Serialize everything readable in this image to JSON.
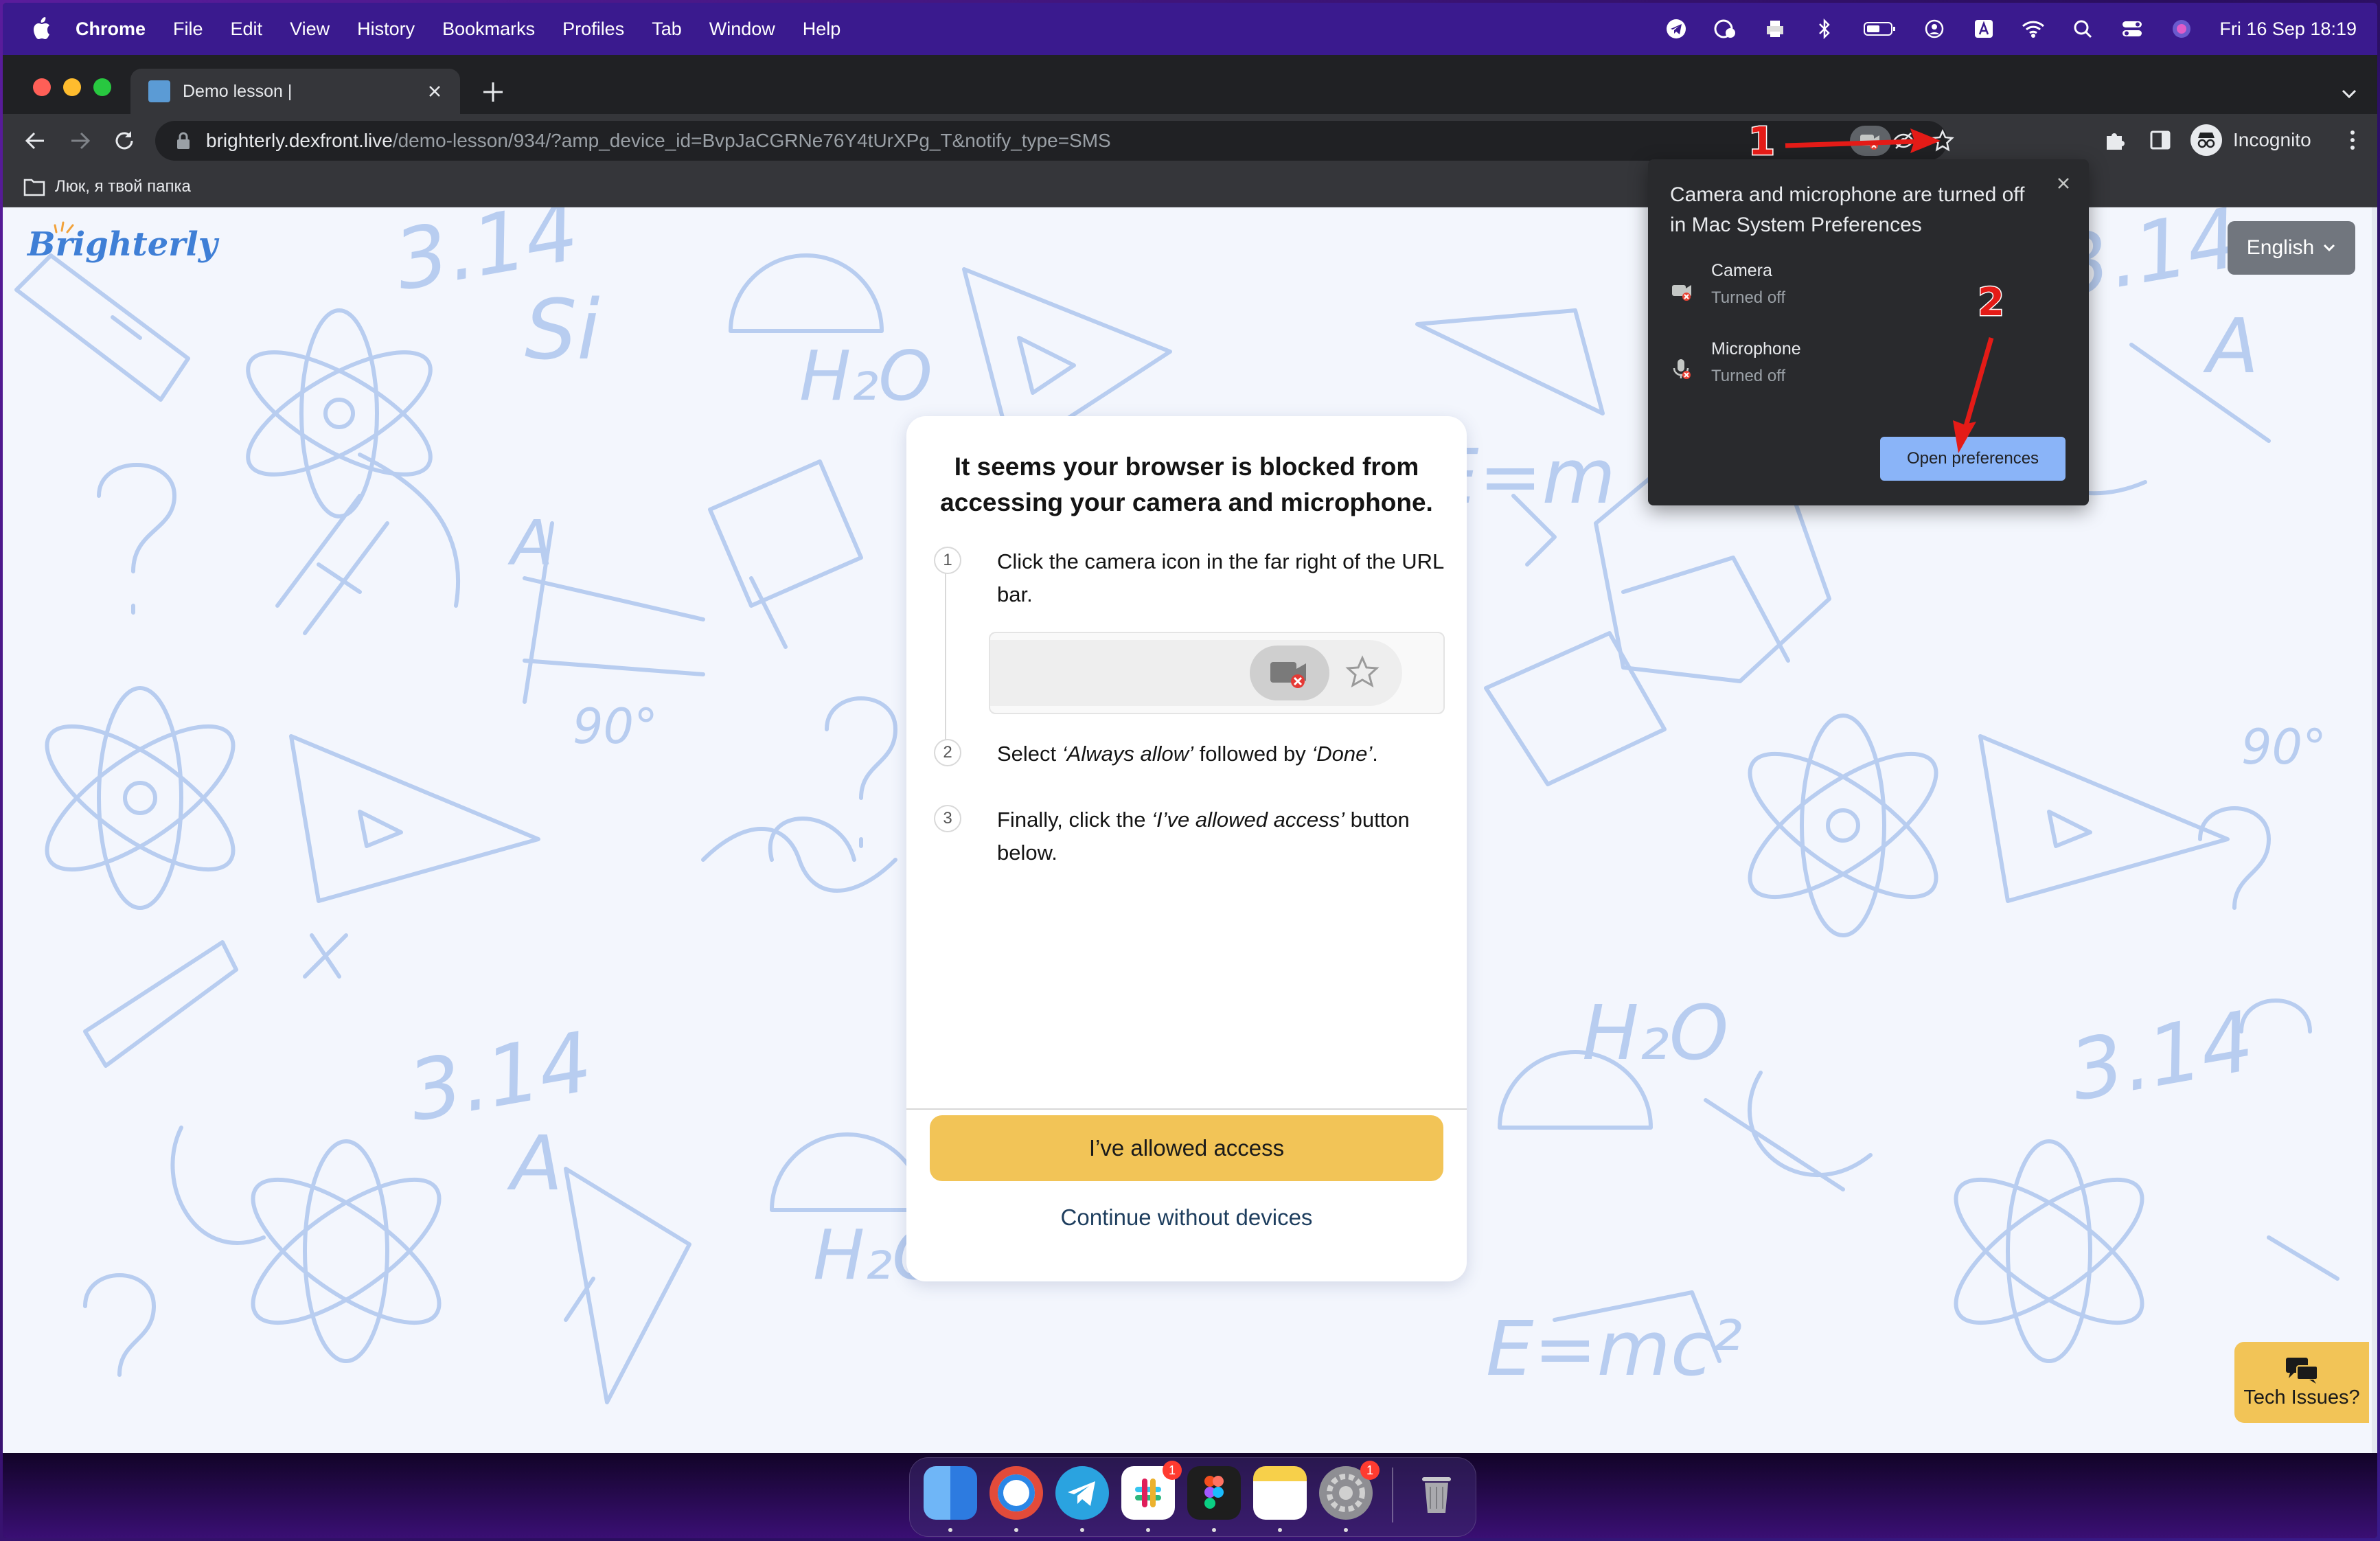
{
  "menubar": {
    "app_name": "Chrome",
    "menus": [
      "File",
      "Edit",
      "View",
      "History",
      "Bookmarks",
      "Profiles",
      "Tab",
      "Window",
      "Help"
    ],
    "clock": "Fri 16 Sep  18:19"
  },
  "browser": {
    "tab_title": "Demo lesson |",
    "url_host": "brighterly.dexfront.live",
    "url_path": "/demo-lesson/934/?amp_device_id=BvpJaCGRNe76Y4tUrXPg_T&notify_type=SMS",
    "profile_label": "Incognito",
    "bookmark_folder": "Люк, я твой папка"
  },
  "page": {
    "logo_text": "Brighterly",
    "language": "English",
    "tech_issues": "Tech Issues?"
  },
  "modal": {
    "title": "It seems your browser is blocked from accessing your camera and microphone.",
    "steps": [
      {
        "num": "1",
        "text": "Click the camera icon in the far right of the URL bar."
      },
      {
        "num": "2",
        "pre": "Select ",
        "em1": "‘Always allow’",
        "mid": " followed by ",
        "em2": "‘Done’",
        "post": "."
      },
      {
        "num": "3",
        "pre": "Finally, click the ",
        "em1": "‘I’ve allowed access’",
        "post": " button below."
      }
    ],
    "allowed_button": "I’ve allowed access",
    "continue_link": "Continue without devices"
  },
  "popup": {
    "title": "Camera and microphone are turned off in Mac System Preferences",
    "camera_label": "Camera",
    "camera_status": "Turned off",
    "mic_label": "Microphone",
    "mic_status": "Turned off",
    "button": "Open preferences"
  },
  "annotations": {
    "mark1": "1",
    "mark2": "2"
  },
  "dock": {
    "apps": [
      "finder-icon",
      "chrome-icon",
      "telegram-icon",
      "slack-icon",
      "figma-icon",
      "notes-icon",
      "system-preferences-icon",
      "trash-icon"
    ],
    "badges": {
      "slack": "1",
      "system_preferences": "1"
    }
  },
  "colors": {
    "accent_yellow": "#f2c457",
    "brand_blue": "#3f7fd6",
    "popup_button": "#8ab4f8",
    "annotation_red": "#e41b17"
  }
}
